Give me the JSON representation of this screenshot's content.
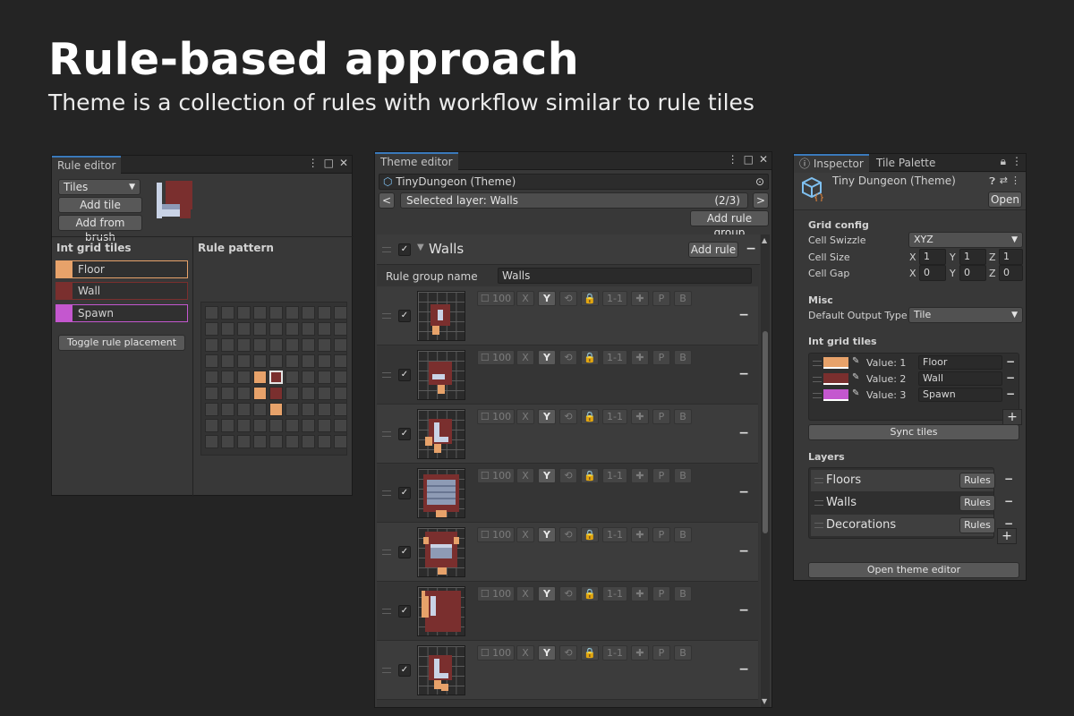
{
  "hero": {
    "title": "Rule-based approach",
    "subtitle": "Theme is a collection of rules with workflow similar to rule tiles"
  },
  "rule_editor": {
    "tab": "Rule editor",
    "tiles_dropdown": "Tiles",
    "add_tile": "Add tile",
    "add_from_brush": "Add from brush",
    "int_grid_header": "Int grid tiles",
    "int_grid_items": [
      {
        "label": "Floor",
        "color": "#e7a26a"
      },
      {
        "label": "Wall",
        "color": "#7a2f2e"
      },
      {
        "label": "Spawn",
        "color": "#c457cf"
      }
    ],
    "toggle_button": "Toggle rule placement",
    "pattern_header": "Rule pattern"
  },
  "theme_editor": {
    "tab": "Theme editor",
    "asset_name": "TinyDungeon (Theme)",
    "prev": "<",
    "next": ">",
    "selected_layer": "Selected layer: Walls",
    "layer_count": "(2/3)",
    "add_rule_group": "Add rule group",
    "group_name": "Walls",
    "add_rule": "Add rule",
    "minus": "−",
    "rule_group_name_label": "Rule group name",
    "rule_group_name_value": "Walls",
    "rule_buttons": [
      "100",
      "X",
      "Y",
      "⟲",
      "🔒",
      "1-1",
      "✚",
      "P",
      "B"
    ],
    "rule_count": 7
  },
  "inspector": {
    "tab_inspector": "Inspector",
    "tab_palette": "Tile Palette",
    "asset_title": "Tiny Dungeon (Theme)",
    "open": "Open",
    "grid_config": "Grid config",
    "cell_swizzle": "Cell Swizzle",
    "swizzle_value": "XYZ",
    "cell_size": "Cell Size",
    "cell_gap": "Cell Gap",
    "axis_x": "X",
    "axis_y": "Y",
    "axis_z": "Z",
    "size_x": "1",
    "size_y": "1",
    "size_z": "1",
    "gap_x": "0",
    "gap_y": "0",
    "gap_z": "0",
    "misc": "Misc",
    "default_output_type": "Default Output Type",
    "output_value": "Tile",
    "int_grid_tiles": "Int grid tiles",
    "values": [
      {
        "label": "Value: 1",
        "name": "Floor",
        "color": "#e7a26a"
      },
      {
        "label": "Value: 2",
        "name": "Wall",
        "color": "#7a2f2e"
      },
      {
        "label": "Value: 3",
        "name": "Spawn",
        "color": "#c457cf"
      }
    ],
    "plus": "+",
    "sync_tiles": "Sync tiles",
    "layers": "Layers",
    "layer_items": [
      "Floors",
      "Walls",
      "Decorations"
    ],
    "rules_button": "Rules",
    "open_theme_editor": "Open theme editor"
  }
}
